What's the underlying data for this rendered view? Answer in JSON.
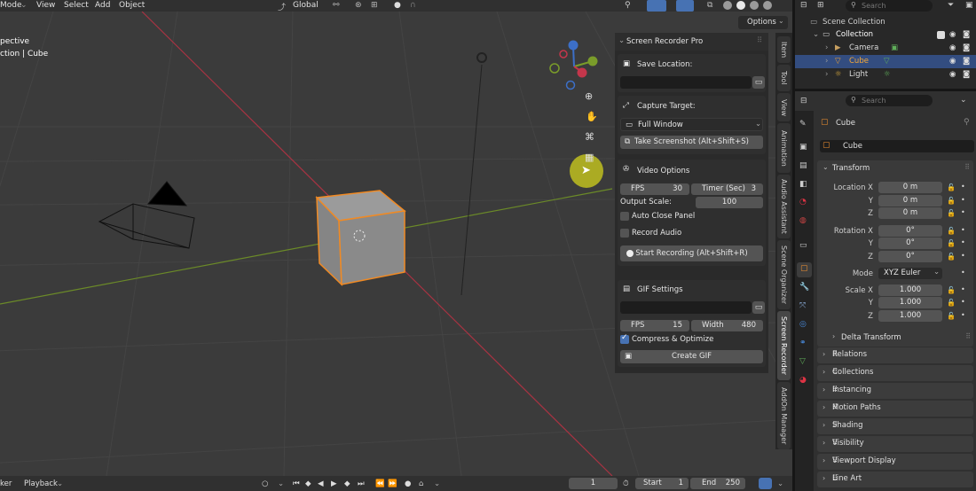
{
  "menu": {
    "mode": "Mode",
    "view": "View",
    "select": "Select",
    "add": "Add",
    "object": "Object",
    "orientation": "Global"
  },
  "header_right": {
    "search_placeholder": "Search",
    "options": "Options"
  },
  "viewport": {
    "perspective_label": "pective",
    "collection_label": "ction | Cube"
  },
  "panel": {
    "title": "Screen Recorder Pro",
    "save_location": {
      "label": "Save Location:",
      "value": ""
    },
    "capture": {
      "label": "Capture Target:",
      "selected": "Full Window",
      "screenshot_button": "Take Screenshot (Alt+Shift+S)"
    },
    "video": {
      "title": "Video Options",
      "fps_label": "FPS",
      "fps_value": "30",
      "timer_label": "Timer (Sec)",
      "timer_value": "3",
      "scale_label": "Output Scale:",
      "scale_value": "100",
      "auto_close_label": "Auto Close Panel",
      "auto_close_checked": false,
      "record_audio_label": "Record Audio",
      "record_audio_checked": false,
      "start_button": "Start Recording (Alt+Shift+R)"
    },
    "gif": {
      "title": "GIF Settings",
      "path_value": "",
      "fps_label": "FPS",
      "fps_value": "15",
      "width_label": "Width",
      "width_value": "480",
      "compress_label": "Compress & Optimize",
      "compress_checked": true,
      "create_button": "Create GIF"
    }
  },
  "vertical_tabs": [
    "Item",
    "Tool",
    "View",
    "Animation",
    "Audio Assistant",
    "Scene Organizer",
    "Screen Recorder",
    "AddOn Manager"
  ],
  "outliner": {
    "search_placeholder": "Search",
    "scene_collection": "Scene Collection",
    "collection": "Collection",
    "items": [
      {
        "name": "Camera"
      },
      {
        "name": "Cube"
      },
      {
        "name": "Light"
      }
    ]
  },
  "properties": {
    "search_placeholder": "Search",
    "object_name": "Cube",
    "object_field": "Cube",
    "transform": {
      "title": "Transform",
      "location_label": "Location X",
      "y_label": "Y",
      "z_label": "Z",
      "location": [
        "0 m",
        "0 m",
        "0 m"
      ],
      "rotation_label": "Rotation X",
      "rotation": [
        "0°",
        "0°",
        "0°"
      ],
      "mode_label": "Mode",
      "mode_value": "XYZ Euler",
      "scale_label": "Scale X",
      "scale": [
        "1.000",
        "1.000",
        "1.000"
      ],
      "delta": "Delta Transform"
    },
    "sections": [
      "Relations",
      "Collections",
      "Instancing",
      "Motion Paths",
      "Shading",
      "Visibility",
      "Viewport Display",
      "Line Art"
    ]
  },
  "timeline": {
    "marker_label": "ker",
    "playback_label": "Playback",
    "current_frame": "1",
    "start_label": "Start",
    "start_value": "1",
    "end_label": "End",
    "end_value": "250"
  },
  "colors": {
    "accent": "#4772b3",
    "selection": "#f08a24",
    "x_axis": "#c4364b",
    "y_axis": "#7a9c2a"
  }
}
